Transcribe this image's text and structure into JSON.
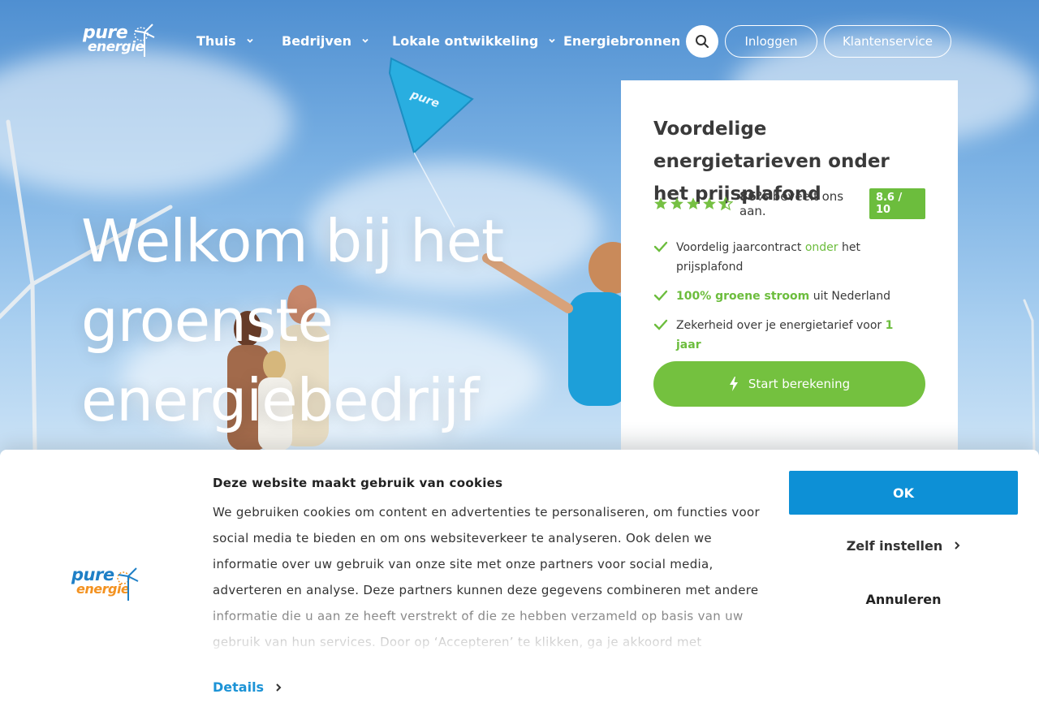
{
  "brand": {
    "logo_word1": "pure",
    "logo_word2": "energie",
    "accent_green": "#74c13f",
    "accent_blue": "#0d90d6",
    "accent_orange": "#f39221"
  },
  "nav": {
    "items": [
      {
        "label": "Thuis",
        "has_dropdown": true
      },
      {
        "label": "Bedrijven",
        "has_dropdown": true
      },
      {
        "label": "Lokale ontwikkeling",
        "has_dropdown": true
      },
      {
        "label": "Energiebronnen",
        "has_dropdown": false
      }
    ],
    "search_icon": "search-icon",
    "login_label": "Inloggen",
    "service_label": "Klantenservice"
  },
  "hero": {
    "title_line1": "Welkom bij het",
    "title_line2": "groenste",
    "title_line3": "energiebedrijf"
  },
  "card": {
    "title": "Voordelige energietarieven onder het prijsplafond",
    "rating": {
      "stars": 4.5,
      "percent": "86%",
      "recommend_text": "beveelt ons aan.",
      "score": "8.6 / 10"
    },
    "usps": [
      {
        "before": "Voordelig jaarcontract ",
        "highlight": "onder",
        "after": " het prijsplafond"
      },
      {
        "before": "",
        "highlight": "100% groene stroom",
        "after": " uit Nederland"
      },
      {
        "before": "Zekerheid over je energietarief voor ",
        "highlight": "1 jaar",
        "after": ""
      }
    ],
    "cta_label": "Start berekening",
    "cta_icon": "lightning-icon"
  },
  "cookie": {
    "title": "Deze website maakt gebruik van cookies",
    "body": "We gebruiken cookies om content en advertenties te personaliseren, om functies voor social media te bieden en om ons websiteverkeer te analyseren. Ook delen we informatie over uw gebruik van onze site met onze partners voor social media, adverteren en analyse. Deze partners kunnen deze gegevens combineren met andere informatie die u aan ze heeft verstrekt of die ze hebben verzameld op basis van uw gebruik van hun services. Door op ‘Accepteren’ te klikken, ga je akkoord met",
    "details_label": "Details",
    "ok_label": "OK",
    "settings_label": "Zelf instellen",
    "cancel_label": "Annuleren"
  }
}
